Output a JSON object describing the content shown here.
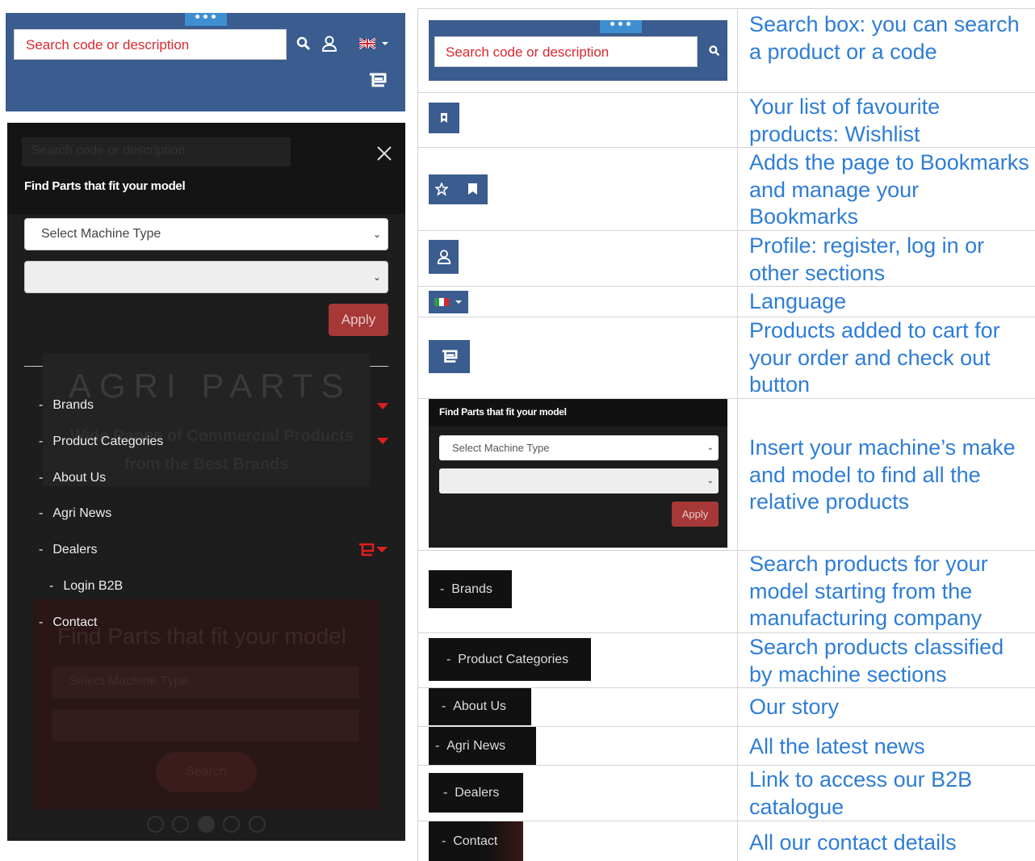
{
  "header": {
    "search_placeholder": "Search code or description"
  },
  "menu": {
    "ghost_search": "Search code or description",
    "find_parts_title": "Find Parts that fit your model",
    "select_machine_type": "Select Machine Type",
    "apply_label": "Apply",
    "banner_title": "AGRI PARTS",
    "banner_line1": "Wide Range of Commercial Products",
    "banner_line2": "from the Best Brands",
    "items": [
      {
        "label": "Brands"
      },
      {
        "label": "Product Categories"
      },
      {
        "label": "About Us"
      },
      {
        "label": "Agri News"
      },
      {
        "label": "Dealers"
      },
      {
        "label": "Login B2B"
      },
      {
        "label": "Contact"
      }
    ],
    "bg_find_parts": "Find Parts that fit your model",
    "bg_select": "Select Machine Type",
    "bg_search": "Search"
  },
  "table": {
    "rows": [
      {
        "desc": "Search box: you can search a product or a code"
      },
      {
        "desc": "Your list of favourite products: Wishlist"
      },
      {
        "desc": "Adds the page to Bookmarks and manage your Bookmarks"
      },
      {
        "desc": "Profile: register, log in or other sections"
      },
      {
        "desc": "Language"
      },
      {
        "desc": "Products added to cart for your order and check out button"
      },
      {
        "desc": "Insert your machine’s make and model to find all the relative products"
      },
      {
        "desc": "Search products for your model starting from the manufacturing company"
      },
      {
        "desc": "Search products classified by machine sections"
      },
      {
        "desc": "Our story"
      },
      {
        "desc": "All the latest news"
      },
      {
        "desc": "Link to access our B2B catalogue"
      },
      {
        "desc": "All our contact details"
      }
    ],
    "thumb_search_placeholder": "Search code or description",
    "thumb_find_parts": "Find Parts that fit your model",
    "thumb_select": "Select Machine Type",
    "thumb_apply": "Apply",
    "thumb_brands": "Brands",
    "thumb_product_categories": "Product Categories",
    "thumb_about_us": "About Us",
    "thumb_agri_news": "Agri News",
    "thumb_dealers": "Dealers",
    "thumb_contact": "Contact"
  },
  "colors": {
    "header_blue": "#3a5c8f",
    "accent_red": "#d9272e",
    "link_blue": "#2e7dd6"
  }
}
